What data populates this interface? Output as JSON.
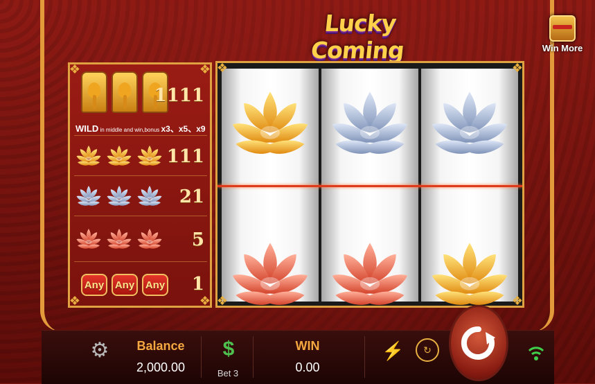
{
  "game": {
    "title": "Lucky Coming",
    "win_more_label": "Win More"
  },
  "paytable": {
    "rows": [
      {
        "symbol": "wild-ganesha",
        "multiplier": "1111"
      },
      {
        "symbol": "gold-lotus",
        "multiplier": "111"
      },
      {
        "symbol": "silver-lotus",
        "multiplier": "21"
      },
      {
        "symbol": "red-lotus",
        "multiplier": "5"
      },
      {
        "symbol": "any",
        "multiplier": "1"
      }
    ],
    "wild_word": "WILD",
    "wild_text": " in middle and win,bonus ",
    "wild_bonus": "x3、x5、x9",
    "any_label": "Any"
  },
  "reels": {
    "top_row": [
      "gold-lotus",
      "silver-lotus",
      "silver-lotus"
    ],
    "bottom_row": [
      "red-lotus",
      "red-lotus",
      "gold-lotus"
    ]
  },
  "bottom_bar": {
    "balance_label": "Balance",
    "balance_value": "2,000.00",
    "bet_label": "Bet 3",
    "win_label": "WIN",
    "win_value": "0.00",
    "icons": [
      "gear-icon",
      "dollar-icon",
      "lightning-icon",
      "autoplay-icon",
      "spin-icon",
      "wifi-icon"
    ]
  },
  "colors": {
    "gold": "#f5b52a",
    "silver": "#a8b8d8",
    "red_lotus": "#e0553a",
    "accent_orange": "#f5a740",
    "payline": "#e03a1c"
  }
}
